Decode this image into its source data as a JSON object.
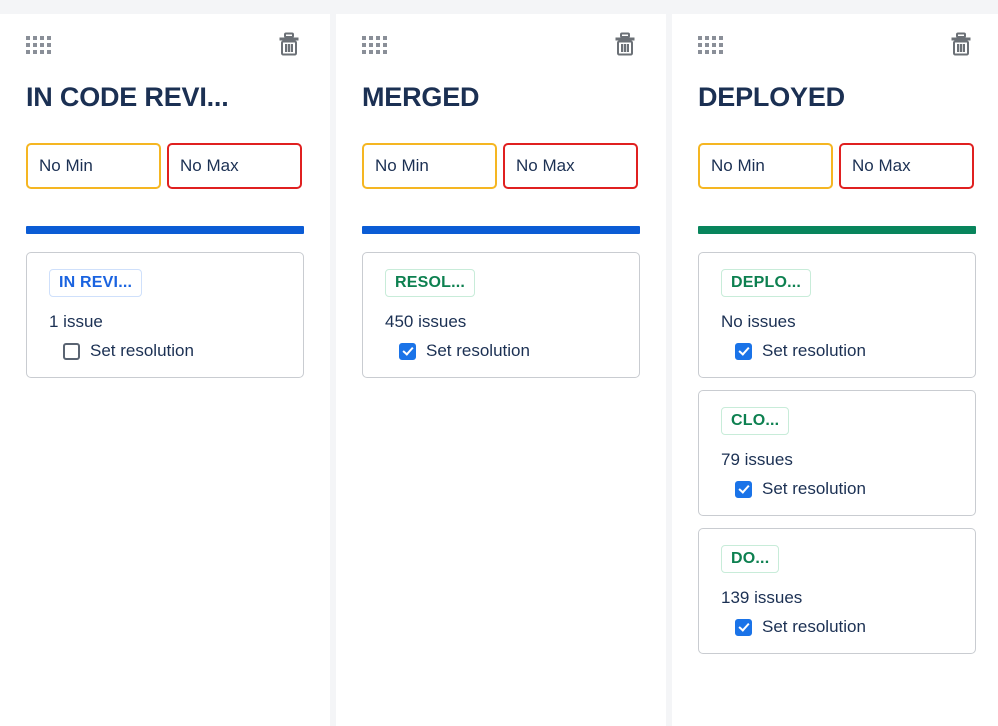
{
  "board": {
    "columns": [
      {
        "id": "in-code-review",
        "drag_handle_icon": "grip-dots-icon",
        "delete_icon": "trash-icon",
        "title": "IN CODE REVI...",
        "min_value": "No Min",
        "min_placeholder": "No Min",
        "max_value": "No Max",
        "max_placeholder": "No Max",
        "divider_color": "#0b5cd5",
        "cards": [
          {
            "badge": "IN REVI...",
            "badge_style": "blue",
            "issues": "1 issue",
            "resolution_label": "Set resolution",
            "resolution_checked": false
          }
        ]
      },
      {
        "id": "merged",
        "drag_handle_icon": "grip-dots-icon",
        "delete_icon": "trash-icon",
        "title": "MERGED",
        "min_value": "No Min",
        "min_placeholder": "No Min",
        "max_value": "No Max",
        "max_placeholder": "No Max",
        "divider_color": "#0b5cd5",
        "cards": [
          {
            "badge": "RESOL...",
            "badge_style": "green",
            "issues": "450 issues",
            "resolution_label": "Set resolution",
            "resolution_checked": true
          }
        ]
      },
      {
        "id": "deployed",
        "drag_handle_icon": "grip-dots-icon",
        "delete_icon": "trash-icon",
        "title": "DEPLOYED",
        "min_value": "No Min",
        "min_placeholder": "No Min",
        "max_value": "No Max",
        "max_placeholder": "No Max",
        "divider_color": "#08855c",
        "cards": [
          {
            "badge": "DEPLO...",
            "badge_style": "green",
            "issues": "No issues",
            "resolution_label": "Set resolution",
            "resolution_checked": true
          },
          {
            "badge": "CLO...",
            "badge_style": "green",
            "issues": "79 issues",
            "resolution_label": "Set resolution",
            "resolution_checked": true
          },
          {
            "badge": "DO...",
            "badge_style": "green",
            "issues": "139 issues",
            "resolution_label": "Set resolution",
            "resolution_checked": true
          }
        ]
      }
    ]
  },
  "colors": {
    "background": "#f4f5f7",
    "title": "#1b3053",
    "min_border": "#f5b622",
    "max_border": "#e02020",
    "divider_blue": "#0b5cd5",
    "divider_green": "#08855c",
    "checkbox_checked": "#1a73e8",
    "badge_blue_text": "#1a63e0",
    "badge_green_text": "#0d8050"
  }
}
